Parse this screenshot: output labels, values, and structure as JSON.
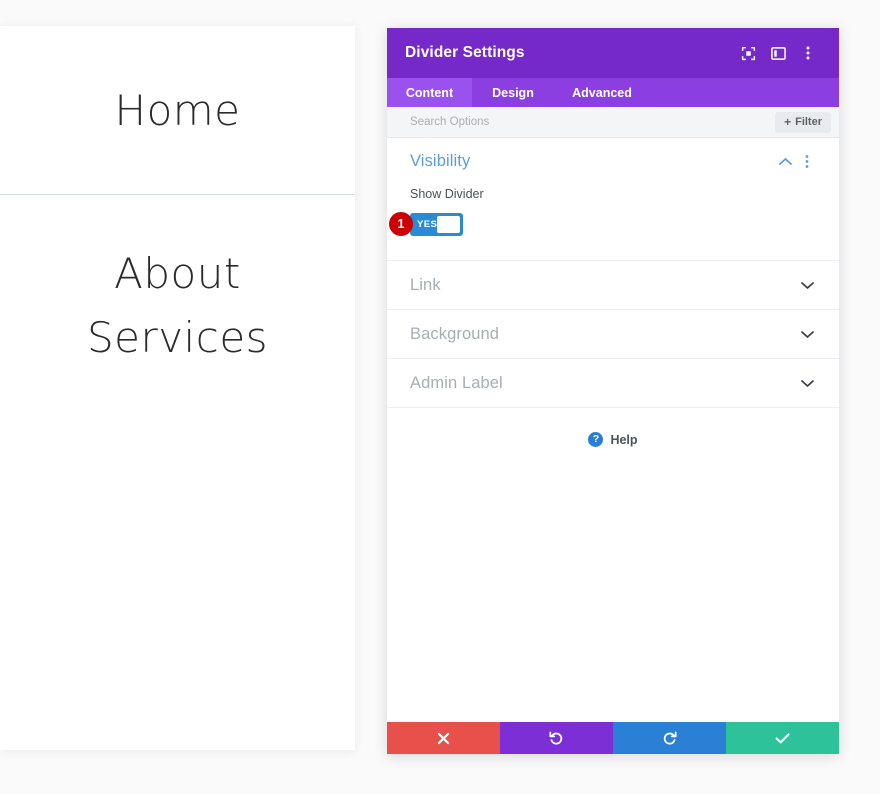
{
  "preview": {
    "items": [
      {
        "label": "Home"
      },
      {
        "label": "About"
      },
      {
        "label": "Services"
      }
    ],
    "divider_name": "horizontal-divider-line"
  },
  "panel": {
    "title": "Divider Settings",
    "header_icons": [
      {
        "name": "expand-view-icon"
      },
      {
        "name": "panel-layout-icon"
      },
      {
        "name": "kebab-menu-icon"
      }
    ],
    "tabs": [
      {
        "label": "Content",
        "active": true
      },
      {
        "label": "Design",
        "active": false
      },
      {
        "label": "Advanced",
        "active": false
      }
    ],
    "search": {
      "placeholder": "Search Options",
      "value": ""
    },
    "filter": {
      "label": "Filter",
      "plus": "+"
    },
    "sections": {
      "visibility": {
        "title": "Visibility",
        "expanded": true,
        "field_label": "Show Divider",
        "toggle": {
          "state_label": "YES",
          "value": true
        },
        "step_badge": "1"
      },
      "collapsed": [
        {
          "title": "Link"
        },
        {
          "title": "Background"
        },
        {
          "title": "Admin Label"
        }
      ]
    },
    "help": {
      "label": "Help",
      "glyph": "?"
    },
    "footer": [
      {
        "name": "cancel-button",
        "icon": "close-icon",
        "color": "#e8504b"
      },
      {
        "name": "undo-button",
        "icon": "undo-icon",
        "color": "#7b2fd4"
      },
      {
        "name": "redo-button",
        "icon": "redo-icon",
        "color": "#2a80d5"
      },
      {
        "name": "save-button",
        "icon": "check-icon",
        "color": "#2ec29a"
      }
    ]
  },
  "colors": {
    "header_purple": "#7529c9",
    "tab_bar_purple": "#8b3fe0",
    "tab_active_purple": "#9a52ef",
    "accent_blue": "#5b9dd9",
    "toggle_blue": "#2a8bd5",
    "badge_red": "#cc0000",
    "divider_line": "#cfdde2"
  }
}
